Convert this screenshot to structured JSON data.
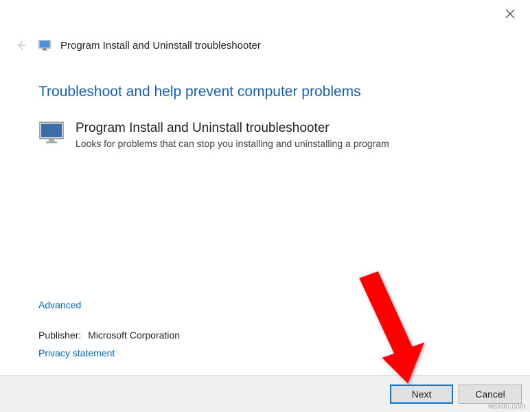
{
  "window": {
    "title": "Program Install and Uninstall troubleshooter"
  },
  "content": {
    "heading": "Troubleshoot and help prevent computer problems",
    "program": {
      "title": "Program Install and Uninstall troubleshooter",
      "description": "Looks for problems that can stop you installing and uninstalling a program"
    }
  },
  "links": {
    "advanced": "Advanced",
    "privacy": "Privacy statement"
  },
  "publisher": {
    "label": "Publisher:",
    "value": "Microsoft Corporation"
  },
  "buttons": {
    "next": "Next",
    "cancel": "Cancel"
  },
  "watermark": "wsxdn.com"
}
